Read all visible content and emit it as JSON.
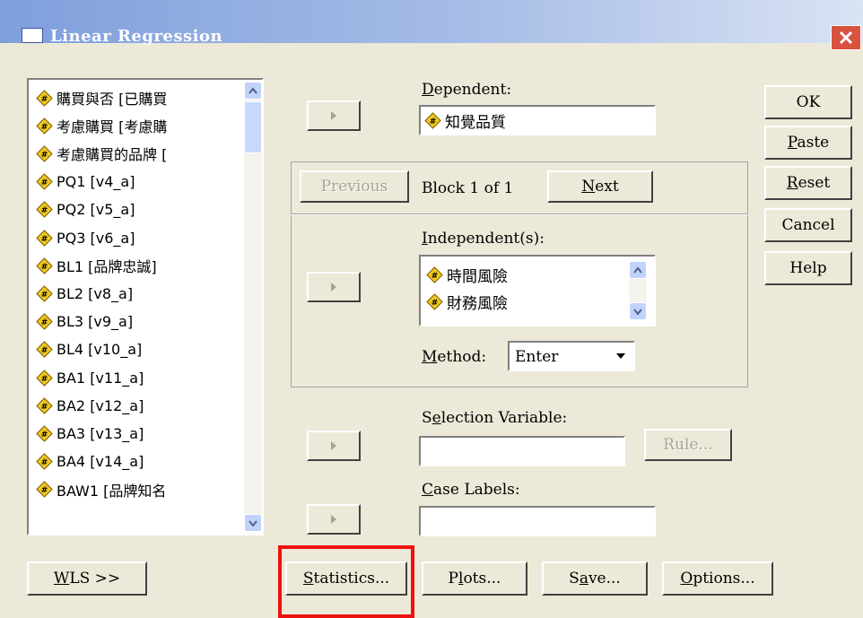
{
  "window": {
    "title": "Linear Regression"
  },
  "variables": [
    "購買與否 [已購買",
    "考慮購買 [考慮購",
    "考慮購買的品牌 [",
    "PQ1 [v4_a]",
    "PQ2 [v5_a]",
    "PQ3 [v6_a]",
    "BL1 [品牌忠誠]",
    "BL2 [v8_a]",
    "BL3 [v9_a]",
    "BL4 [v10_a]",
    "BA1 [v11_a]",
    "BA2 [v12_a]",
    "BA3 [v13_a]",
    "BA4 [v14_a]",
    "BAW1 [品牌知名"
  ],
  "dependent": {
    "label": "Dependent:",
    "value": "知覺品質"
  },
  "block": {
    "previous": "Previous",
    "text": "Block 1 of 1",
    "next": "Next"
  },
  "independent": {
    "label": "Independent(s):",
    "items": [
      "時間風險",
      "財務風險"
    ]
  },
  "method": {
    "label": "Method:",
    "value": "Enter"
  },
  "selection": {
    "label": "Selection Variable:",
    "rule": "Rule..."
  },
  "case_labels": {
    "label": "Case Labels:"
  },
  "right_buttons": [
    "OK",
    "Paste",
    "Reset",
    "Cancel",
    "Help"
  ],
  "bottom_buttons": {
    "wls": "WLS >>",
    "statistics": "Statistics...",
    "plots": "Plots...",
    "save": "Save...",
    "options": "Options..."
  },
  "colors": {
    "titlebar": "#7f9fdc",
    "highlight": "#ee1111",
    "dialog": "#ece9d8"
  }
}
